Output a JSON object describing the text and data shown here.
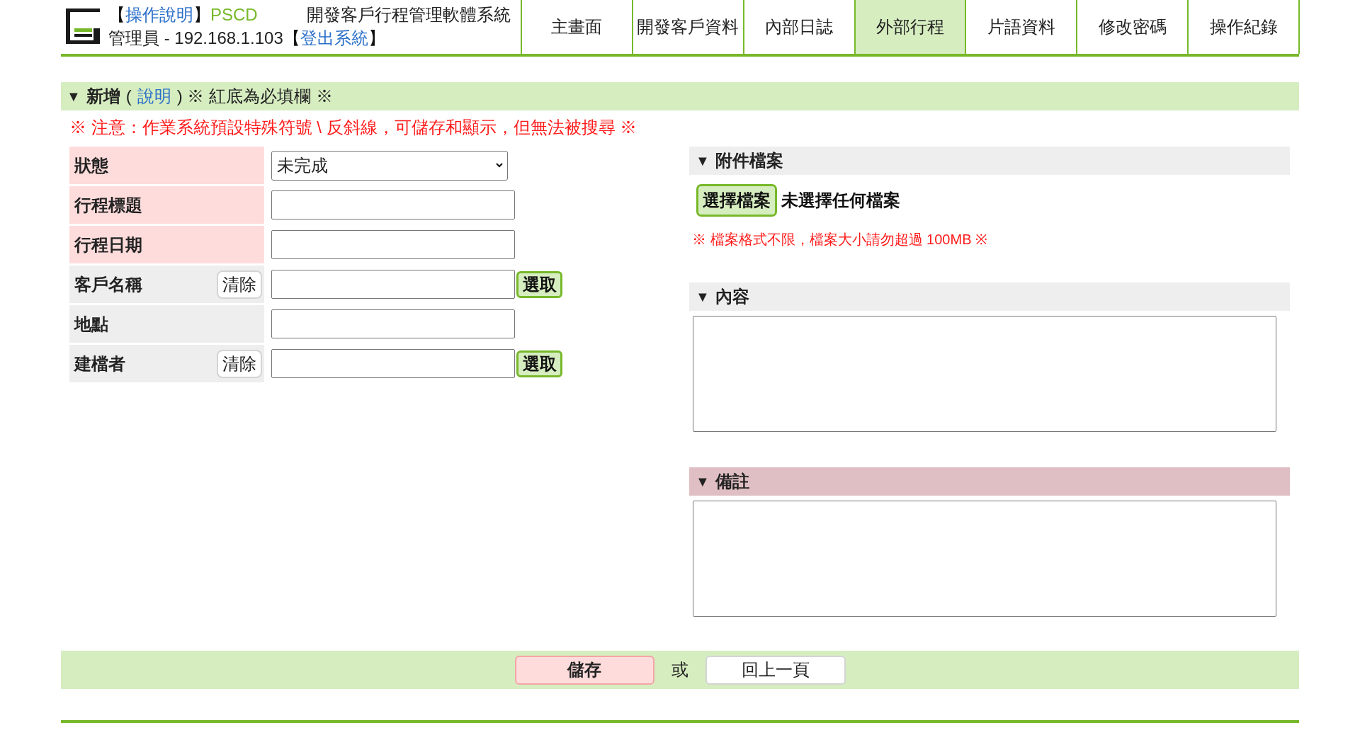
{
  "header": {
    "help_link": {
      "open": "【",
      "label": "操作說明",
      "close": "】"
    },
    "brand": "PSCD",
    "system_name": "開發客戶行程管理軟體系統",
    "user": "管理員 - 192.168.1.103",
    "logout_link": {
      "open": "【",
      "label": "登出系統",
      "close": "】"
    }
  },
  "nav": [
    {
      "label": "主畫面",
      "selected": false
    },
    {
      "label": "開發客戶資料",
      "selected": false
    },
    {
      "label": "內部日誌",
      "selected": false
    },
    {
      "label": "外部行程",
      "selected": true
    },
    {
      "label": "片語資料",
      "selected": false
    },
    {
      "label": "修改密碼",
      "selected": false
    },
    {
      "label": "操作紀錄",
      "selected": false
    }
  ],
  "section": {
    "toggle": "▼",
    "title": "新增",
    "paren_open": "(",
    "help_link": "說明",
    "note": ") ※ 紅底為必填欄 ※"
  },
  "warning": "※ 注意：作業系統預設特殊符號 \\ 反斜線，可儲存和顯示，但無法被搜尋 ※",
  "form": [
    {
      "label": "狀態",
      "required": true,
      "kind": "select",
      "value": "未完成"
    },
    {
      "label": "行程標題",
      "required": true,
      "kind": "text"
    },
    {
      "label": "行程日期",
      "required": true,
      "kind": "text"
    },
    {
      "label": "客戶名稱",
      "required": false,
      "kind": "picker",
      "clear_button": "清除",
      "pick_button": "選取"
    },
    {
      "label": "地點",
      "required": false,
      "kind": "text"
    },
    {
      "label": "建檔者",
      "required": false,
      "kind": "picker",
      "clear_button": "清除",
      "pick_button": "選取"
    }
  ],
  "panels": [
    {
      "kind": "file",
      "toggle": "▼",
      "title": "附件檔案",
      "required": false,
      "choose_button": "選擇檔案",
      "file_status": "未選擇任何檔案",
      "note": "※ 檔案格式不限，檔案大小請勿超過 100MB ※"
    },
    {
      "kind": "textarea",
      "toggle": "▼",
      "title": "內容",
      "required": false
    },
    {
      "kind": "textarea",
      "toggle": "▼",
      "title": "備註",
      "required": true
    }
  ],
  "footer": {
    "save_button": "儲存",
    "or": "或",
    "back_button": "回上一頁"
  }
}
